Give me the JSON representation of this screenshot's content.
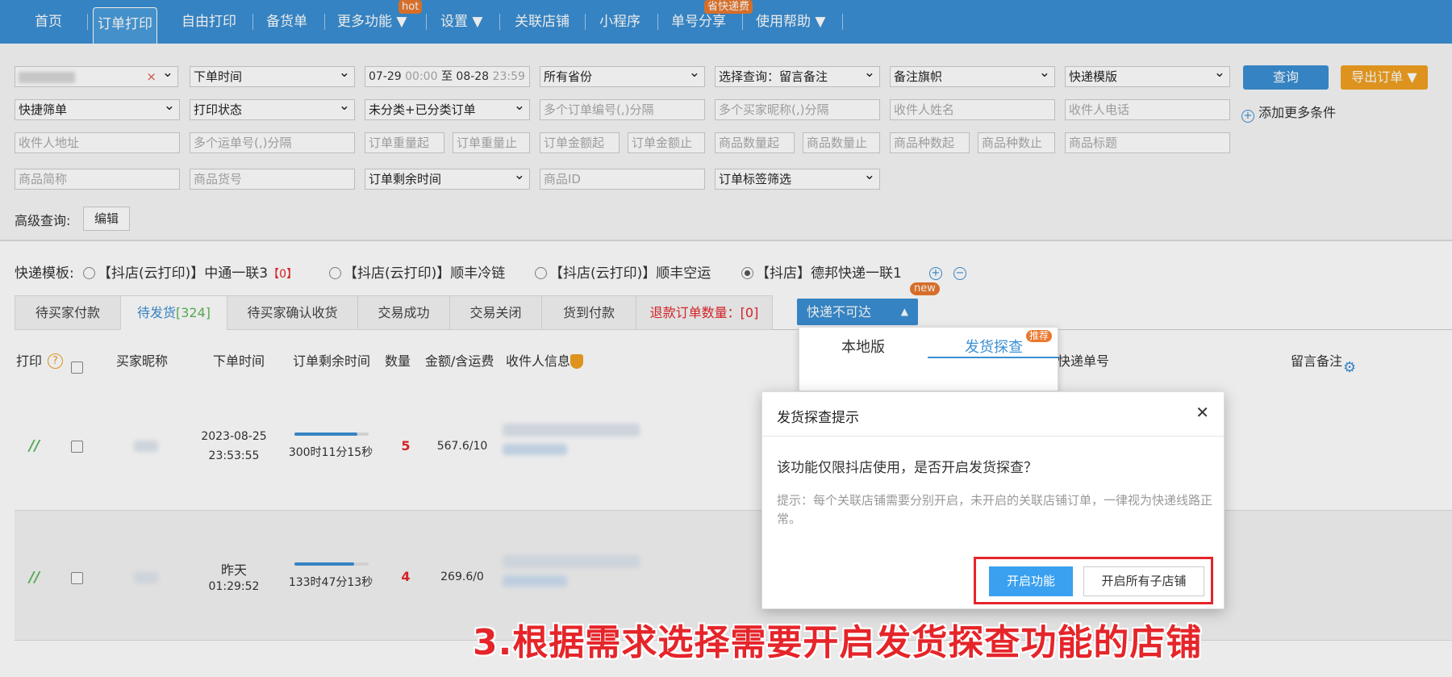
{
  "nav": {
    "items": [
      "首页",
      "订单打印",
      "自由打印",
      "备货单",
      "更多功能 ▼",
      "设置 ▼",
      "关联店铺",
      "小程序",
      "单号分享",
      "使用帮助 ▼"
    ],
    "hot_tag": "hot",
    "promo_tag": "省快递费",
    "active_index": 1
  },
  "filters": {
    "row1": {
      "shop_clear": "×",
      "order_time": "下单时间",
      "date_from": "07-29",
      "time_from": "00:00",
      "date_sep": "至",
      "date_to": "08-28",
      "time_to": "23:59",
      "province": "所有省份",
      "query_select": "选择查询：留言备注",
      "remark_flag": "备注旗帜",
      "express_template": "快递模版",
      "query_button": "查询",
      "export_button": "导出订单 ▼"
    },
    "row2": {
      "quick_filter": "快捷筛单",
      "print_status": "打印状态",
      "category": "未分类+已分类订单",
      "order_ids_ph": "多个订单编号(,)分隔",
      "buyer_nicks_ph": "多个买家昵称(,)分隔",
      "receiver_name_ph": "收件人姓名",
      "receiver_phone_ph": "收件人电话",
      "add_more": "添加更多条件"
    },
    "row3": {
      "address_ph": "收件人地址",
      "tracking_ph": "多个运单号(,)分隔",
      "weight_from_ph": "订单重量起",
      "weight_to_ph": "订单重量止",
      "amount_from_ph": "订单金额起",
      "amount_to_ph": "订单金额止",
      "qty_from_ph": "商品数量起",
      "qty_to_ph": "商品数量止",
      "kinds_from_ph": "商品种数起",
      "kinds_to_ph": "商品种数止",
      "title_ph": "商品标题"
    },
    "row4": {
      "short_name_ph": "商品简称",
      "goods_no_ph": "商品货号",
      "remaining_time": "订单剩余时间",
      "goods_id_ph": "商品ID",
      "tag_filter": "订单标签筛选"
    },
    "advanced_label": "高级查询:",
    "edit_button": "编辑"
  },
  "templates": {
    "label": "快递模板:",
    "options": [
      {
        "name": "【抖店(云打印)】中通一联3",
        "count": "【0】",
        "selected": false
      },
      {
        "name": "【抖店(云打印)】顺丰冷链",
        "count": "",
        "selected": false
      },
      {
        "name": "【抖店(云打印)】顺丰空运",
        "count": "",
        "selected": false
      },
      {
        "name": "【抖店】德邦快递一联1",
        "count": "",
        "selected": true
      }
    ]
  },
  "tabs": [
    {
      "label": "待买家付款",
      "count": ""
    },
    {
      "label": "待发货",
      "count": "[324]"
    },
    {
      "label": "待买家确认收货",
      "count": ""
    },
    {
      "label": "交易成功",
      "count": ""
    },
    {
      "label": "交易关闭",
      "count": ""
    },
    {
      "label": "货到付款",
      "count": ""
    },
    {
      "label": "退款订单数量：[0]",
      "count": ""
    }
  ],
  "unreachable": {
    "label": "快递不可达",
    "new_tag": "new"
  },
  "table": {
    "headers": [
      "打印",
      "买家昵称",
      "下单时间",
      "订单剩余时间",
      "数量",
      "金额/含运费",
      "收件人信息",
      "快递单号",
      "留言备注"
    ],
    "rows": [
      {
        "time1": "2023-08-25",
        "time2": "23:53:55",
        "remaining": "300时11分15秒",
        "progress": 0.85,
        "qty": "5",
        "amount": "567.6/10"
      },
      {
        "time1": "昨天",
        "time2": "01:29:52",
        "remaining": "133时47分13秒",
        "progress": 0.8,
        "qty": "4",
        "amount": "269.6/0"
      }
    ]
  },
  "panel": {
    "tab1": "本地版",
    "tab2": "发货探查",
    "recommend_tag": "推荐"
  },
  "dialog": {
    "title": "发货探查提示",
    "close": "✕",
    "question": "该功能仅限抖店使用，是否开启发货探查？",
    "tip": "提示：每个关联店铺需要分别开启，未开启的关联店铺订单，一律视为快递线路正常。",
    "enable_button": "开启功能",
    "enable_all_button": "开启所有子店铺"
  },
  "caption": "3.根据需求选择需要开启发货探查功能的店铺",
  "colors": {
    "nav": "#3a8fd3",
    "accent_orange": "#f0a020",
    "red": "#e5252a"
  }
}
